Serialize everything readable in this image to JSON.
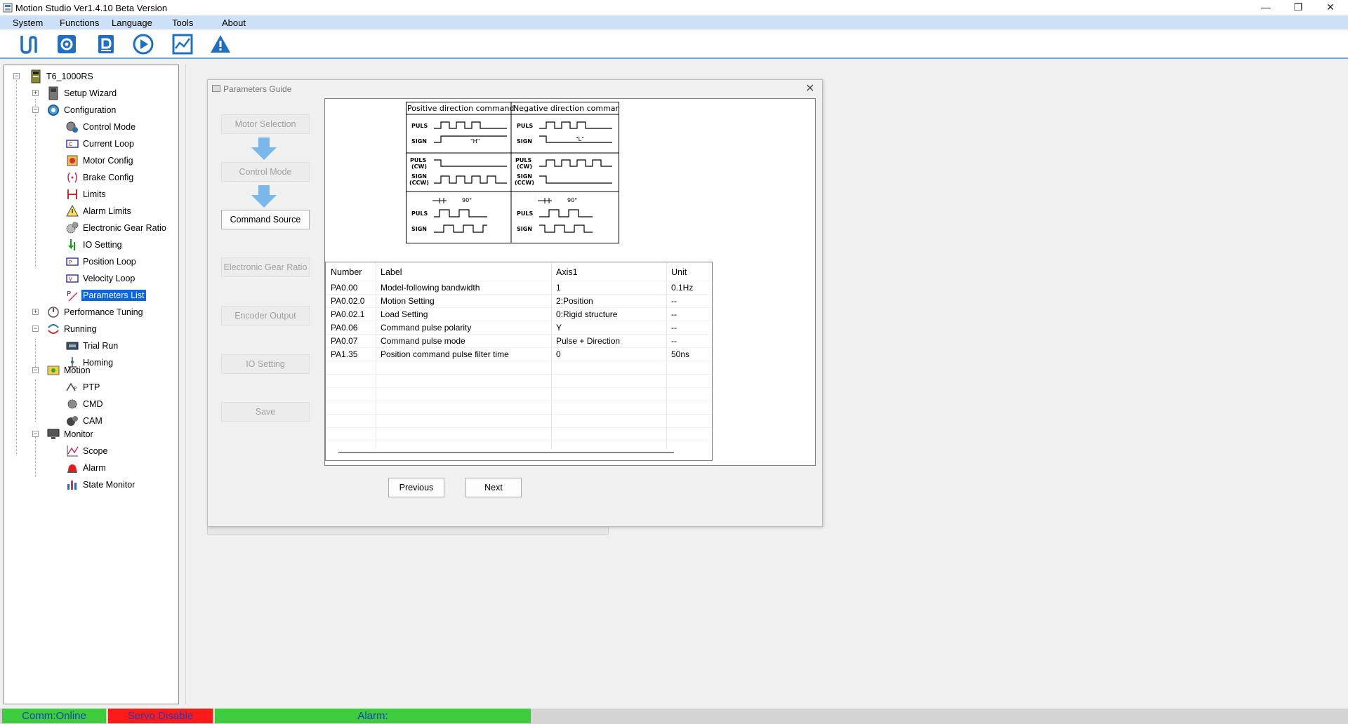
{
  "window": {
    "title": "Motion Studio  Ver1.4.10 Beta Version",
    "controls": {
      "minimize": "—",
      "maximize": "❐",
      "close": "✕"
    }
  },
  "menu": [
    "System",
    "Functions",
    "Language",
    "Tools",
    "About"
  ],
  "toolbar_icons": [
    "connect-icon",
    "settings-icon",
    "drive-icon",
    "play-icon",
    "chart-icon",
    "warning-icon"
  ],
  "tree": {
    "root": "T6_1000RS",
    "setup_wizard": "Setup Wizard",
    "configuration": "Configuration",
    "control_mode": "Control Mode",
    "current_loop": "Current Loop",
    "motor_config": "Motor Config",
    "brake_config": "Brake Config",
    "limits": "Limits",
    "alarm_limits": "Alarm Limits",
    "electronic_gear_ratio": "Electronic Gear Ratio",
    "io_setting": "IO Setting",
    "position_loop": "Position Loop",
    "velocity_loop": "Velocity Loop",
    "parameters_list": "Parameters List",
    "performance_tuning": "Performance Tuning",
    "running": "Running",
    "trial_run": "Trial Run",
    "homing": "Homing",
    "motion": "Motion",
    "ptp": "PTP",
    "cmd": "CMD",
    "cam": "CAM",
    "monitor": "Monitor",
    "scope": "Scope",
    "alarm": "Alarm",
    "state_monitor": "State Monitor"
  },
  "dialog": {
    "title": "Parameters Guide",
    "close": "✕",
    "steps": {
      "motor_selection": "Motor Selection",
      "control_mode": "Control Mode",
      "command_source": "Command Source",
      "electronic_gear_ratio": "Electronic Gear Ratio",
      "encoder_output": "Encoder Output",
      "io_setting": "IO Setting",
      "save": "Save"
    },
    "diagram": {
      "positive_header": "Positive direction command",
      "negative_header": "Negative direction command",
      "puls": "PULS",
      "sign": "SIGN",
      "puls_cw_1": "PULS",
      "puls_cw_2": "(CW)",
      "sign_ccw_1": "SIGN",
      "sign_ccw_2": "(CCW)",
      "high": "\"H\"",
      "low": "\"L\"",
      "deg90": "90°"
    },
    "table": {
      "headers": {
        "number": "Number",
        "label": "Label",
        "axis": "Axis1",
        "unit": "Unit"
      },
      "rows": [
        {
          "number": "PA0.00",
          "label": "Model-following bandwidth",
          "value": "1",
          "unit": "0.1Hz"
        },
        {
          "number": "PA0.02.0",
          "label": "Motion Setting",
          "value": "2:Position",
          "unit": "--"
        },
        {
          "number": "PA0.02.1",
          "label": "Load Setting",
          "value": "0:Rigid structure",
          "unit": "--"
        },
        {
          "number": "PA0.06",
          "label": "Command pulse polarity",
          "value": "Y",
          "unit": "--"
        },
        {
          "number": "PA0.07",
          "label": "Command pulse mode",
          "value": "Pulse + Direction",
          "unit": "--"
        },
        {
          "number": "PA1.35",
          "label": "Position command pulse filter time",
          "value": "0",
          "unit": "50ns"
        }
      ]
    },
    "previous": "Previous",
    "next": "Next"
  },
  "status": {
    "comm": "Comm:Online",
    "servo": "Servo Disable",
    "alarm": "Alarm:",
    "colors": {
      "comm_bg": "#3ecb3e",
      "servo_bg": "#ff1a1a",
      "alarm_bg": "#3ecb3e"
    }
  }
}
